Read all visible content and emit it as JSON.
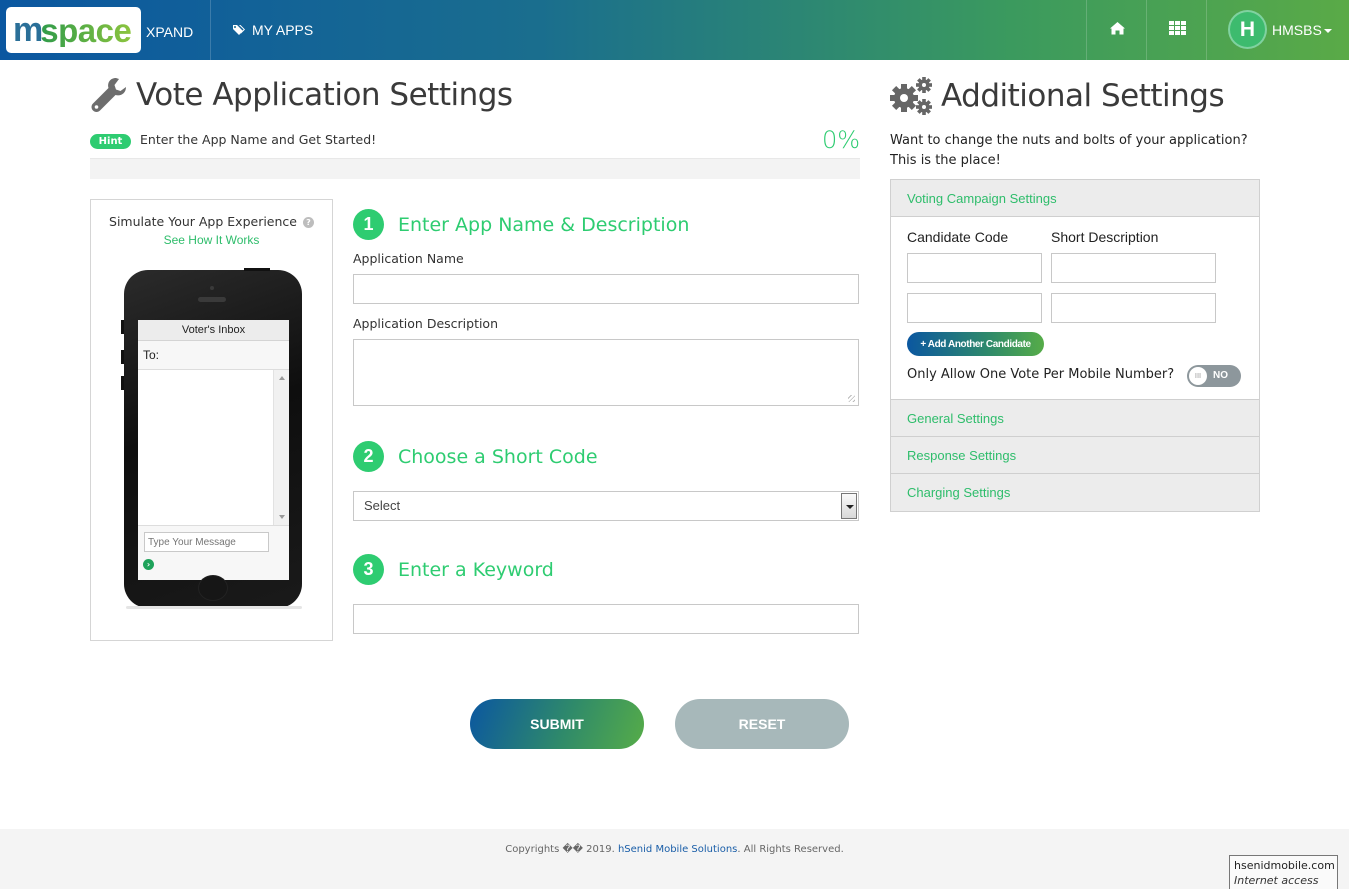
{
  "navbar": {
    "logo_m": "m",
    "logo_space": "space",
    "product": "XPAND",
    "my_apps": "MY APPS",
    "avatar_initial": "H",
    "username": "HMSBS",
    "icons": [
      "tags-icon",
      "home-icon",
      "apps-grid-icon"
    ]
  },
  "main": {
    "title": "Vote Application Settings",
    "hint_badge": "Hint",
    "hint_text": "Enter the App Name and Get Started!",
    "progress_label": "0%",
    "progress_value": 0
  },
  "simulator": {
    "title": "Simulate Your App Experience",
    "help_glyph": "?",
    "link": "See How It Works",
    "inbox_title": "Voter's Inbox",
    "to_label": "To:",
    "message_placeholder": "Type Your Message",
    "send_glyph": "›"
  },
  "steps": [
    {
      "num": "1",
      "title": "Enter App Name & Description"
    },
    {
      "num": "2",
      "title": "Choose a Short Code"
    },
    {
      "num": "3",
      "title": "Enter a Keyword"
    }
  ],
  "form": {
    "app_name_label": "Application Name",
    "app_name_value": "",
    "app_desc_label": "Application Description",
    "app_desc_value": "",
    "short_code_selected": "Select",
    "keyword_value": "",
    "submit_label": "SUBMIT",
    "reset_label": "RESET"
  },
  "additional": {
    "title": "Additional Settings",
    "desc_line1": "Want to change the nuts and bolts of your application?",
    "desc_line2": "This is the place!",
    "sections": [
      {
        "label": "Voting Campaign Settings",
        "expanded": true
      },
      {
        "label": "General Settings",
        "expanded": false
      },
      {
        "label": "Response Settings",
        "expanded": false
      },
      {
        "label": "Charging Settings",
        "expanded": false
      }
    ],
    "voting": {
      "col_code": "Candidate Code",
      "col_desc": "Short Description",
      "candidates": [
        {
          "code": "",
          "description": ""
        },
        {
          "code": "",
          "description": ""
        }
      ],
      "add_button": "+ Add Another Candidate",
      "one_vote_label": "Only Allow One Vote Per Mobile Number?",
      "one_vote_toggle": "NO",
      "toggle_knob_glyph": "III"
    }
  },
  "footer": {
    "prefix": "Copyrights �� 2019. ",
    "company": "hSenid Mobile Solutions",
    "suffix": ". All Rights Reserved."
  },
  "tooltip": {
    "line1": "hsenidmobile.com",
    "line2": "Internet access"
  }
}
